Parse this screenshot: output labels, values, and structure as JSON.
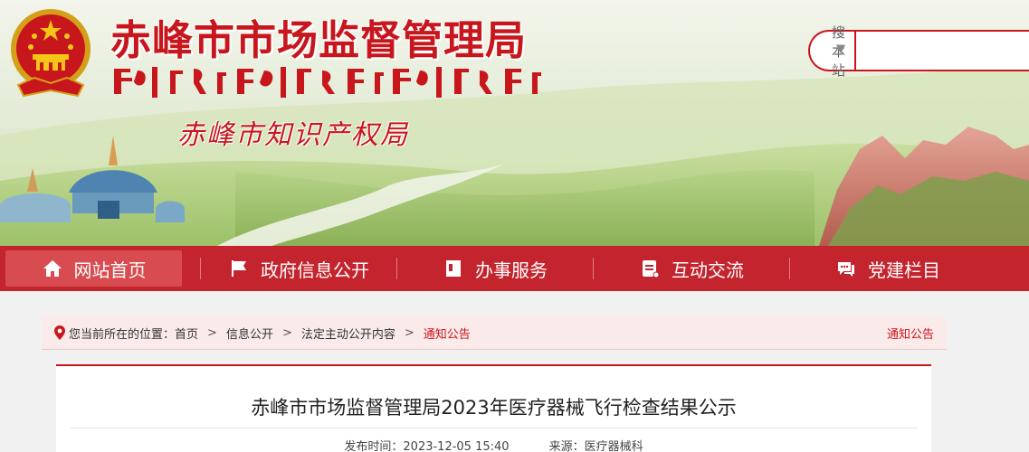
{
  "header": {
    "site_title": "赤峰市市场监督管理局",
    "site_subtitle": "赤峰市知识产权局"
  },
  "search": {
    "scope_label": "搜本站",
    "placeholder": ""
  },
  "nav": {
    "items": [
      {
        "label": "网站首页",
        "icon": "home-icon"
      },
      {
        "label": "政府信息公开",
        "icon": "flag-icon"
      },
      {
        "label": "办事服务",
        "icon": "document-icon"
      },
      {
        "label": "互动交流",
        "icon": "notepad-icon"
      },
      {
        "label": "党建栏目",
        "icon": "chat-icon"
      }
    ]
  },
  "breadcrumb": {
    "prefix": "您当前所在的位置：",
    "items": [
      "首页",
      "信息公开",
      "法定主动公开内容",
      "通知公告"
    ],
    "section_label": "通知公告"
  },
  "article": {
    "title": "赤峰市市场监督管理局2023年医疗器械飞行检查结果公示",
    "publish_label": "发布时间：",
    "publish_time": "2023-12-05 15:40",
    "source_label": "来源：",
    "source": "医疗器械科"
  },
  "colors": {
    "brand_red": "#c8161d",
    "nav_red": "#c4242d",
    "nav_active": "#d84c51",
    "breadcrumb_bg": "#fbeaea"
  }
}
